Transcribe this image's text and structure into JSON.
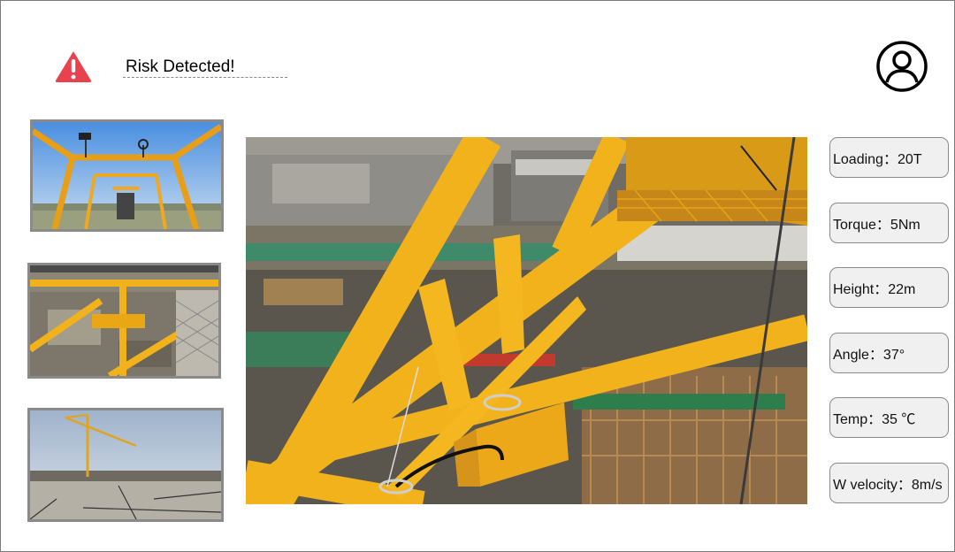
{
  "header": {
    "alert_icon": "warning-triangle-icon",
    "alert_color": "#e8424f",
    "alert_text": "Risk Detected!",
    "user_icon": "user-avatar-icon"
  },
  "thumbnails": [
    {
      "name": "crane-top-sensors-camera"
    },
    {
      "name": "crane-mast-mounted-box-camera"
    },
    {
      "name": "site-overview-tower-crane-camera"
    }
  ],
  "main_view": {
    "name": "sensor-mount-on-crane-jib"
  },
  "metrics": [
    {
      "label": "Loading：20T"
    },
    {
      "label": "Torque：5Nm"
    },
    {
      "label": "Height：22m"
    },
    {
      "label": "Angle：37°"
    },
    {
      "label": "Temp：35 ℃"
    },
    {
      "label": "W velocity：8m/s"
    }
  ],
  "colors": {
    "crane_yellow": "#f2b21c",
    "metric_bg": "#f0f0f0",
    "border": "#8a8a8a"
  }
}
